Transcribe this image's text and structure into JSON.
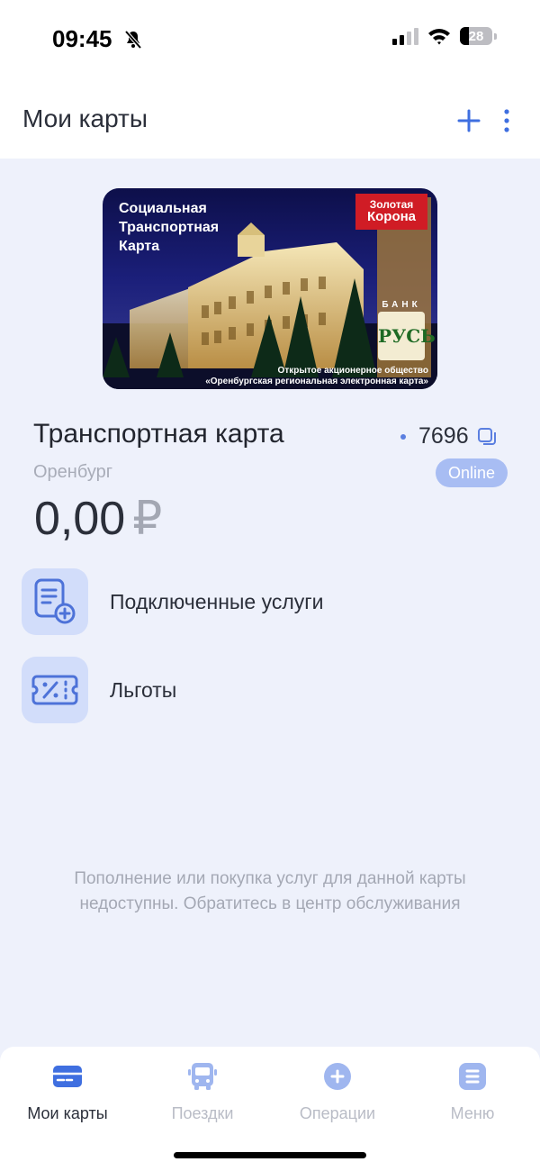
{
  "status_bar": {
    "time": "09:45",
    "battery": "28"
  },
  "header": {
    "title": "Мои карты"
  },
  "card": {
    "image_title": "Социальная Транспортная Карта",
    "image_footer_line1": "Открытое акционерное общество",
    "image_footer_line2": "«Оренбургская региональная электронная карта»",
    "logo_zk_line1": "Золотая",
    "logo_zk_line2": "Корона",
    "logo_bank": "БАНК",
    "logo_rus": "РУСЬ",
    "name": "Транспортная карта",
    "number": "7696",
    "city": "Оренбург",
    "status": "Online",
    "balance": "0,00",
    "currency": "₽"
  },
  "actions": [
    {
      "label": "Подключенные услуги",
      "icon": "document-plus-icon"
    },
    {
      "label": "Льготы",
      "icon": "discount-ticket-icon"
    }
  ],
  "notice": "Пополнение или покупка услуг для данной карты недоступны. Обратитесь в центр обслуживания",
  "bottom_nav": [
    {
      "label": "Мои карты",
      "icon": "card-icon",
      "active": true
    },
    {
      "label": "Поездки",
      "icon": "bus-icon",
      "active": false
    },
    {
      "label": "Операции",
      "icon": "plus-circle-icon",
      "active": false
    },
    {
      "label": "Меню",
      "icon": "menu-icon",
      "active": false
    }
  ],
  "colors": {
    "accent": "#3f6fe0",
    "background": "#eef1fb",
    "icon_tile": "#d2ddfa",
    "badge": "#a8bdf3"
  }
}
